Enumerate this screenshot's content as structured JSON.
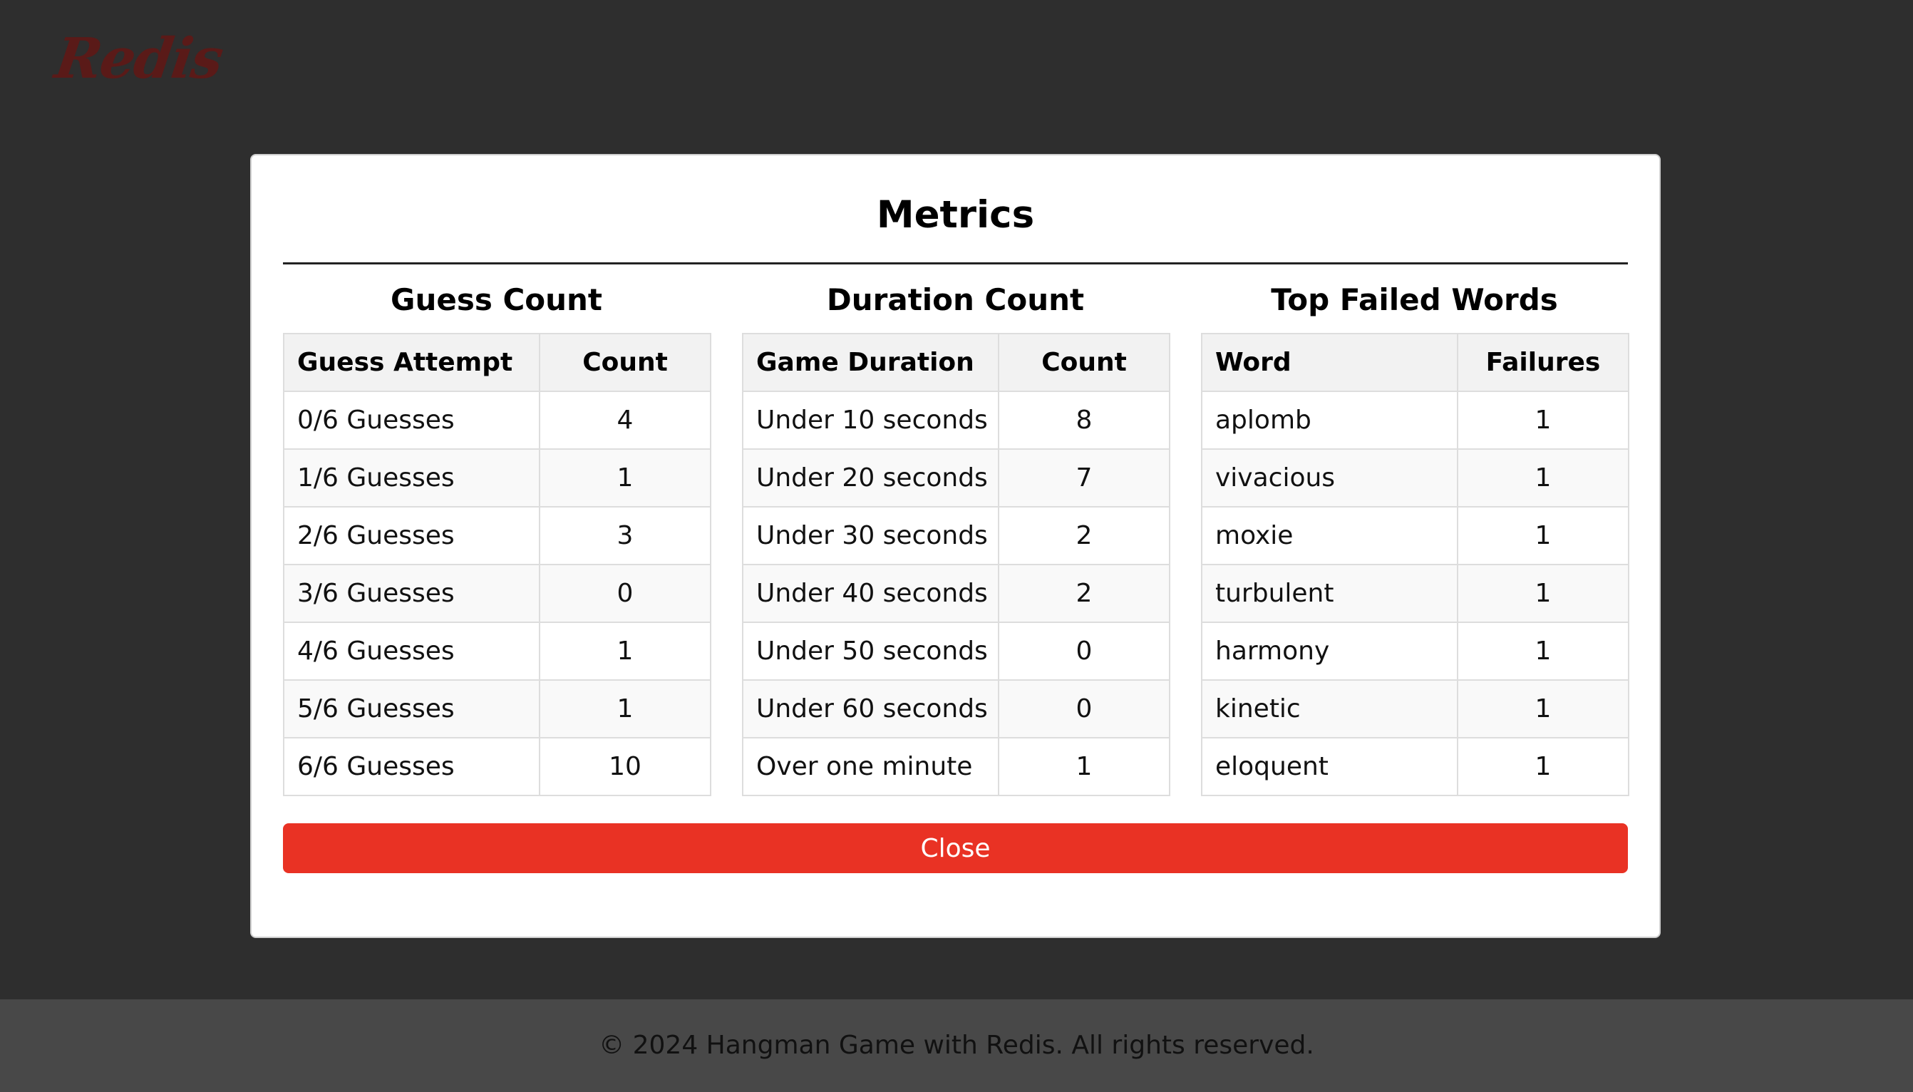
{
  "app": {
    "logo_text": "Redis",
    "brand_color": "#5a1a18",
    "background_color": "#2e2e2e"
  },
  "modal": {
    "title": "Metrics",
    "close_label": "Close",
    "close_color": "#e93224",
    "guess_table": {
      "heading": "Guess Count",
      "columns": [
        "Guess Attempt",
        "Count"
      ],
      "rows": [
        [
          "0/6 Guesses",
          "4"
        ],
        [
          "1/6 Guesses",
          "1"
        ],
        [
          "2/6 Guesses",
          "3"
        ],
        [
          "3/6 Guesses",
          "0"
        ],
        [
          "4/6 Guesses",
          "1"
        ],
        [
          "5/6 Guesses",
          "1"
        ],
        [
          "6/6 Guesses",
          "10"
        ]
      ]
    },
    "duration_table": {
      "heading": "Duration Count",
      "columns": [
        "Game Duration",
        "Count"
      ],
      "rows": [
        [
          "Under 10 seconds",
          "8"
        ],
        [
          "Under 20 seconds",
          "7"
        ],
        [
          "Under 30 seconds",
          "2"
        ],
        [
          "Under 40 seconds",
          "2"
        ],
        [
          "Under 50 seconds",
          "0"
        ],
        [
          "Under 60 seconds",
          "0"
        ],
        [
          "Over one minute",
          "1"
        ]
      ]
    },
    "failed_table": {
      "heading": "Top Failed Words",
      "columns": [
        "Word",
        "Failures"
      ],
      "rows": [
        [
          "aplomb",
          "1"
        ],
        [
          "vivacious",
          "1"
        ],
        [
          "moxie",
          "1"
        ],
        [
          "turbulent",
          "1"
        ],
        [
          "harmony",
          "1"
        ],
        [
          "kinetic",
          "1"
        ],
        [
          "eloquent",
          "1"
        ]
      ]
    }
  },
  "footer": {
    "text": "© 2024 Hangman Game with Redis. All rights reserved."
  }
}
